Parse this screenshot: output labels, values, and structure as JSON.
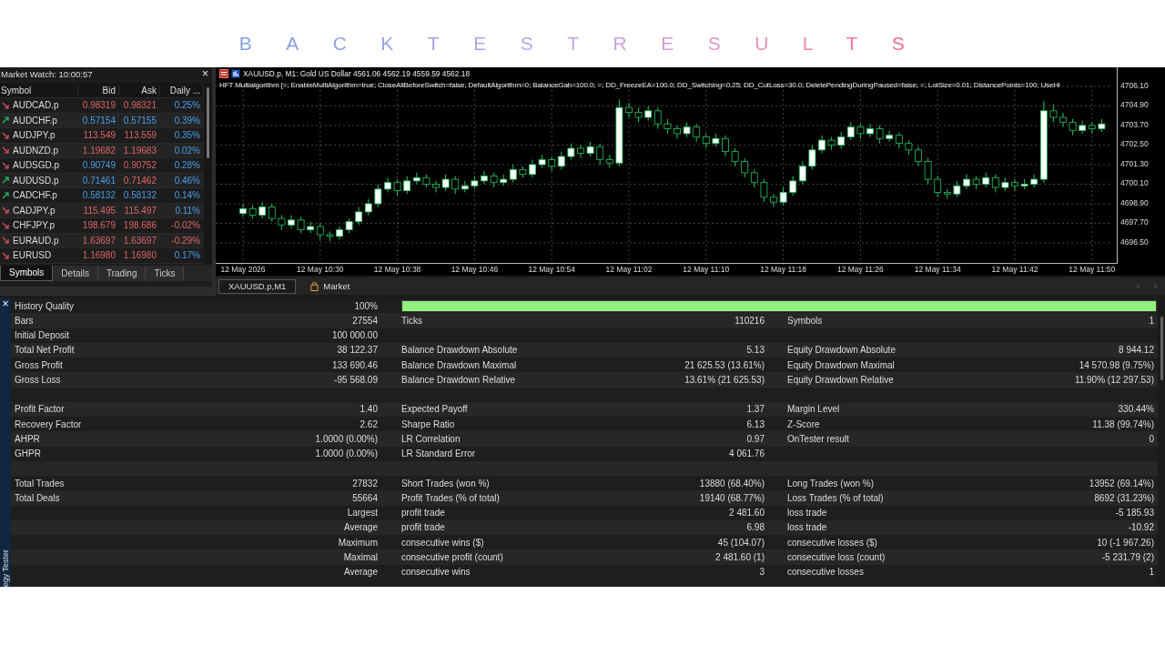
{
  "title": "BACKTESTRESULTS",
  "market_watch": {
    "title": "Market Watch: 10:00:57",
    "close": "×",
    "columns": [
      "Symbol",
      "Bid",
      "Ask",
      "Daily ..."
    ],
    "rows": [
      {
        "symbol": "AUDCAD.p",
        "bid": "0.98319",
        "ask": "0.98321",
        "change": "0.25%",
        "rising": false,
        "bid_up": false,
        "ask_up": false,
        "change_up": true
      },
      {
        "symbol": "AUDCHF.p",
        "bid": "0.57154",
        "ask": "0.57155",
        "change": "0.39%",
        "rising": true,
        "bid_up": true,
        "ask_up": true,
        "change_up": true
      },
      {
        "symbol": "AUDJPY.p",
        "bid": "113.549",
        "ask": "113.559",
        "change": "0.35%",
        "rising": false,
        "bid_up": false,
        "ask_up": false,
        "change_up": true
      },
      {
        "symbol": "AUDNZD.p",
        "bid": "1.19682",
        "ask": "1.19683",
        "change": "0.02%",
        "rising": false,
        "bid_up": false,
        "ask_up": false,
        "change_up": true
      },
      {
        "symbol": "AUDSGD.p",
        "bid": "0.90749",
        "ask": "0.90752",
        "change": "0.28%",
        "rising": false,
        "bid_up": true,
        "ask_up": false,
        "change_up": true
      },
      {
        "symbol": "AUDUSD.p",
        "bid": "0.71461",
        "ask": "0.71462",
        "change": "0.46%",
        "rising": true,
        "bid_up": true,
        "ask_up": false,
        "change_up": true
      },
      {
        "symbol": "CADCHF.p",
        "bid": "0.58132",
        "ask": "0.58132",
        "change": "0.14%",
        "rising": true,
        "bid_up": true,
        "ask_up": true,
        "change_up": true
      },
      {
        "symbol": "CADJPY.p",
        "bid": "115.495",
        "ask": "115.497",
        "change": "0.11%",
        "rising": false,
        "bid_up": false,
        "ask_up": false,
        "change_up": true
      },
      {
        "symbol": "CHFJPY.p",
        "bid": "198.679",
        "ask": "198.686",
        "change": "-0.02%",
        "rising": false,
        "bid_up": false,
        "ask_up": false,
        "change_up": false
      },
      {
        "symbol": "EURAUD.p",
        "bid": "1.63697",
        "ask": "1.63697",
        "change": "-0.29%",
        "rising": false,
        "bid_up": false,
        "ask_up": false,
        "change_up": false
      },
      {
        "symbol": "EURUSD",
        "bid": "1.16980",
        "ask": "1.16980",
        "change": "0.17%",
        "rising": false,
        "bid_up": false,
        "ask_up": false,
        "change_up": true
      }
    ],
    "tabs": [
      {
        "label": "Symbols",
        "selected": true
      },
      {
        "label": "Details",
        "selected": false
      },
      {
        "label": "Trading",
        "selected": false
      },
      {
        "label": "Ticks",
        "selected": false
      }
    ]
  },
  "chart": {
    "header": "XAUUSD.p, M1:  Gold US Dollar  4561.06 4562.19 4559.59 4562.18",
    "expert": "HFT Multialgorithm [=; EnableMultiAlgorithm=true; CloseAllBeforeSwitch=false; DefaultAlgorithm=0; BalanceGab=100.0; =; DD_FreezeEA=100.0; DD_Switching=0.25; DD_CutLoss=30.0; DeletePendingDuringPaused=false; =; LotSize=0.01; DistancePoints=100; UseHi",
    "chart_data": {
      "type": "candlestick",
      "grid": true,
      "ylim": [
        4695.27,
        4707.27
      ],
      "yticks": [
        {
          "value": 4706.1,
          "label": "4706.10"
        },
        {
          "value": 4704.9,
          "label": "4704.90"
        },
        {
          "value": 4703.7,
          "label": "4703.70"
        },
        {
          "value": 4702.5,
          "label": "4702.50"
        },
        {
          "value": 4701.3,
          "label": "4701.30"
        },
        {
          "value": 4700.1,
          "label": "4700.10"
        },
        {
          "value": 4698.9,
          "label": "4698.90"
        },
        {
          "value": 4697.7,
          "label": "4697.70"
        },
        {
          "value": 4696.5,
          "label": "4696.50"
        }
      ],
      "categories": [
        "12 May 2026",
        null,
        null,
        null,
        null,
        null,
        null,
        null,
        "12 May 10:30",
        null,
        null,
        null,
        null,
        null,
        null,
        null,
        "12 May 10:38",
        null,
        null,
        null,
        null,
        null,
        null,
        null,
        "12 May 10:46",
        null,
        null,
        null,
        null,
        null,
        null,
        null,
        "12 May 10:54",
        null,
        null,
        null,
        null,
        null,
        null,
        null,
        "12 May 11:02",
        null,
        null,
        null,
        null,
        null,
        null,
        null,
        "12 May 11:10",
        null,
        null,
        null,
        null,
        null,
        null,
        null,
        "12 May 11:18",
        null,
        null,
        null,
        null,
        null,
        null,
        null,
        "12 May 11:26",
        null,
        null,
        null,
        null,
        null,
        null,
        null,
        "12 May 11:34",
        null,
        null,
        null,
        null,
        null,
        null,
        null,
        "12 May 11:42",
        null,
        null,
        null,
        null,
        null,
        null,
        null,
        "12 May 11:50",
        null
      ],
      "ohlc": [
        [
          4698.3,
          4698.9,
          4698.1,
          4698.6
        ],
        [
          4698.6,
          4698.8,
          4698.0,
          4698.2
        ],
        [
          4698.2,
          4699.0,
          4698.0,
          4698.7
        ],
        [
          4698.7,
          4698.9,
          4697.8,
          4698.0
        ],
        [
          4698.0,
          4698.2,
          4697.3,
          4697.6
        ],
        [
          4697.6,
          4698.2,
          4697.4,
          4697.9
        ],
        [
          4697.9,
          4698.1,
          4697.1,
          4697.3
        ],
        [
          4697.3,
          4697.8,
          4697.1,
          4697.5
        ],
        [
          4697.5,
          4697.7,
          4696.7,
          4697.0
        ],
        [
          4697.0,
          4697.2,
          4696.6,
          4696.9
        ],
        [
          4696.9,
          4697.5,
          4696.7,
          4697.3
        ],
        [
          4697.3,
          4698.0,
          4697.1,
          4697.8
        ],
        [
          4697.8,
          4698.7,
          4697.6,
          4698.4
        ],
        [
          4698.4,
          4699.2,
          4698.2,
          4698.9
        ],
        [
          4698.9,
          4700.1,
          4698.7,
          4699.8
        ],
        [
          4699.8,
          4700.5,
          4699.6,
          4700.2
        ],
        [
          4700.2,
          4700.4,
          4699.4,
          4699.7
        ],
        [
          4699.7,
          4700.6,
          4699.5,
          4700.3
        ],
        [
          4700.3,
          4700.8,
          4700.1,
          4700.5
        ],
        [
          4700.5,
          4700.7,
          4699.9,
          4700.1
        ],
        [
          4700.1,
          4700.3,
          4699.6,
          4699.9
        ],
        [
          4699.9,
          4700.7,
          4699.7,
          4700.4
        ],
        [
          4700.4,
          4700.6,
          4699.5,
          4699.8
        ],
        [
          4699.8,
          4700.3,
          4699.6,
          4700.0
        ],
        [
          4700.0,
          4700.6,
          4699.8,
          4700.3
        ],
        [
          4700.3,
          4700.9,
          4700.1,
          4700.6
        ],
        [
          4700.6,
          4700.8,
          4699.9,
          4700.2
        ],
        [
          4700.2,
          4700.7,
          4700.0,
          4700.4
        ],
        [
          4700.4,
          4701.3,
          4700.2,
          4701.0
        ],
        [
          4701.0,
          4701.2,
          4700.5,
          4700.7
        ],
        [
          4700.7,
          4701.6,
          4700.5,
          4701.3
        ],
        [
          4701.3,
          4701.9,
          4701.1,
          4701.6
        ],
        [
          4701.6,
          4701.8,
          4700.9,
          4701.2
        ],
        [
          4701.2,
          4702.1,
          4701.0,
          4701.8
        ],
        [
          4701.8,
          4702.6,
          4701.6,
          4702.3
        ],
        [
          4702.3,
          4702.5,
          4701.7,
          4702.0
        ],
        [
          4702.0,
          4702.7,
          4701.8,
          4702.4
        ],
        [
          4702.4,
          4702.6,
          4701.3,
          4701.6
        ],
        [
          4701.6,
          4701.9,
          4701.1,
          4701.4
        ],
        [
          4701.4,
          4705.3,
          4701.2,
          4704.8
        ],
        [
          4704.8,
          4705.1,
          4704.2,
          4704.5
        ],
        [
          4704.5,
          4704.8,
          4703.9,
          4704.2
        ],
        [
          4704.2,
          4704.9,
          4704.0,
          4704.6
        ],
        [
          4704.6,
          4704.8,
          4703.5,
          4703.8
        ],
        [
          4703.8,
          4704.1,
          4703.2,
          4703.5
        ],
        [
          4703.5,
          4703.7,
          4702.9,
          4703.2
        ],
        [
          4703.2,
          4703.9,
          4703.0,
          4703.6
        ],
        [
          4703.6,
          4703.8,
          4702.7,
          4703.0
        ],
        [
          4703.0,
          4703.2,
          4702.3,
          4702.6
        ],
        [
          4702.6,
          4703.2,
          4702.4,
          4702.9
        ],
        [
          4702.9,
          4703.1,
          4701.8,
          4702.1
        ],
        [
          4702.1,
          4702.3,
          4701.2,
          4701.5
        ],
        [
          4701.5,
          4701.7,
          4700.5,
          4700.8
        ],
        [
          4700.8,
          4701.0,
          4699.9,
          4700.2
        ],
        [
          4700.2,
          4700.4,
          4699.0,
          4699.3
        ],
        [
          4699.3,
          4699.5,
          4698.7,
          4699.0
        ],
        [
          4699.0,
          4699.9,
          4698.8,
          4699.6
        ],
        [
          4699.6,
          4700.6,
          4699.4,
          4700.3
        ],
        [
          4700.3,
          4701.5,
          4700.1,
          4701.2
        ],
        [
          4701.2,
          4702.5,
          4701.0,
          4702.2
        ],
        [
          4702.2,
          4703.1,
          4702.0,
          4702.8
        ],
        [
          4702.8,
          4703.0,
          4702.2,
          4702.5
        ],
        [
          4702.5,
          4703.3,
          4702.3,
          4703.0
        ],
        [
          4703.0,
          4703.9,
          4702.8,
          4703.6
        ],
        [
          4703.6,
          4703.8,
          4702.9,
          4703.2
        ],
        [
          4703.2,
          4703.8,
          4703.0,
          4703.5
        ],
        [
          4703.5,
          4703.7,
          4702.6,
          4702.9
        ],
        [
          4702.9,
          4703.4,
          4702.7,
          4703.1
        ],
        [
          4703.1,
          4703.3,
          4702.3,
          4702.6
        ],
        [
          4702.6,
          4702.8,
          4701.9,
          4702.2
        ],
        [
          4702.2,
          4702.4,
          4701.2,
          4701.5
        ],
        [
          4701.5,
          4701.7,
          4700.1,
          4700.4
        ],
        [
          4700.4,
          4700.6,
          4699.3,
          4699.6
        ],
        [
          4699.6,
          4699.8,
          4699.2,
          4699.5
        ],
        [
          4699.5,
          4700.3,
          4699.3,
          4700.0
        ],
        [
          4700.0,
          4700.7,
          4699.8,
          4700.4
        ],
        [
          4700.4,
          4700.6,
          4699.8,
          4700.1
        ],
        [
          4700.1,
          4700.8,
          4699.9,
          4700.5
        ],
        [
          4700.5,
          4700.7,
          4699.6,
          4699.9
        ],
        [
          4699.9,
          4700.5,
          4699.7,
          4700.2
        ],
        [
          4700.2,
          4700.4,
          4699.7,
          4700.0
        ],
        [
          4700.0,
          4700.4,
          4699.8,
          4700.1
        ],
        [
          4700.1,
          4700.7,
          4699.9,
          4700.4
        ],
        [
          4700.4,
          4705.2,
          4700.2,
          4704.6
        ],
        [
          4704.6,
          4705.0,
          4703.9,
          4704.2
        ],
        [
          4704.2,
          4704.5,
          4703.6,
          4703.9
        ],
        [
          4703.9,
          4704.1,
          4703.1,
          4703.4
        ],
        [
          4703.4,
          4704.0,
          4703.2,
          4703.7
        ],
        [
          4703.7,
          4703.9,
          4703.2,
          4703.5
        ],
        [
          4703.5,
          4704.1,
          4703.3,
          4703.8
        ]
      ]
    },
    "tabs": [
      {
        "label": "XAUUSD.p,M1",
        "selected": true,
        "kind": "chart"
      },
      {
        "label": "Market",
        "selected": false,
        "kind": "market"
      }
    ]
  },
  "tester": {
    "side_label": "egy Tester",
    "close": "×",
    "rows": [
      {
        "kind": "quality",
        "label": "History Quality",
        "value": "100%",
        "level": 1.0
      },
      {
        "kind": "stats",
        "cells": [
          {
            "label": "Bars",
            "value": "27554"
          },
          {
            "label": "Ticks",
            "value": "110216"
          },
          {
            "label": "Symbols",
            "value": "1"
          }
        ]
      },
      {
        "kind": "stats",
        "cells": [
          {
            "label": "Initial Deposit",
            "value": "100 000.00"
          },
          null,
          null
        ]
      },
      {
        "kind": "stats",
        "cells": [
          {
            "label": "Total Net Profit",
            "value": "38 122.37"
          },
          {
            "label": "Balance Drawdown Absolute",
            "value": "5.13"
          },
          {
            "label": "Equity Drawdown Absolute",
            "value": "8 944.12"
          }
        ]
      },
      {
        "kind": "stats",
        "cells": [
          {
            "label": "Gross Profit",
            "value": "133 690.46"
          },
          {
            "label": "Balance Drawdown Maximal",
            "value": "21 625.53 (13.61%)"
          },
          {
            "label": "Equity Drawdown Maximal",
            "value": "14 570.98 (9.75%)"
          }
        ]
      },
      {
        "kind": "stats",
        "cells": [
          {
            "label": "Gross Loss",
            "value": "-95 568.09"
          },
          {
            "label": "Balance Drawdown Relative",
            "value": "13.61% (21 625.53)"
          },
          {
            "label": "Equity Drawdown Relative",
            "value": "11.90% (12 297.53)"
          }
        ]
      },
      {
        "kind": "blank"
      },
      {
        "kind": "stats",
        "cells": [
          {
            "label": "Profit Factor",
            "value": "1.40"
          },
          {
            "label": "Expected Payoff",
            "value": "1.37"
          },
          {
            "label": "Margin Level",
            "value": "330.44%"
          }
        ]
      },
      {
        "kind": "stats",
        "cells": [
          {
            "label": "Recovery Factor",
            "value": "2.62"
          },
          {
            "label": "Sharpe Ratio",
            "value": "6.13"
          },
          {
            "label": "Z-Score",
            "value": "11.38 (99.74%)"
          }
        ]
      },
      {
        "kind": "stats",
        "cells": [
          {
            "label": "AHPR",
            "value": "1.0000 (0.00%)"
          },
          {
            "label": "LR Correlation",
            "value": "0.97"
          },
          {
            "label": "OnTester result",
            "value": "0"
          }
        ]
      },
      {
        "kind": "stats",
        "cells": [
          {
            "label": "GHPR",
            "value": "1.0000 (0.00%)"
          },
          {
            "label": "LR Standard Error",
            "value": "4 061.76"
          },
          null
        ]
      },
      {
        "kind": "blank"
      },
      {
        "kind": "stats",
        "cells": [
          {
            "label": "Total Trades",
            "value": "27832"
          },
          {
            "label": "Short Trades (won %)",
            "value": "13880 (68.40%)"
          },
          {
            "label": "Long Trades (won %)",
            "value": "13952 (69.14%)"
          }
        ]
      },
      {
        "kind": "stats",
        "cells": [
          {
            "label": "Total Deals",
            "value": "55664"
          },
          {
            "label": "Profit Trades (% of total)",
            "value": "19140 (68.77%)"
          },
          {
            "label": "Loss Trades (% of total)",
            "value": "8692 (31.23%)"
          }
        ]
      },
      {
        "kind": "stats",
        "cells": [
          {
            "value": "Largest"
          },
          {
            "label": "profit trade",
            "value": "2 481.60"
          },
          {
            "label": "loss trade",
            "value": "-5 185.93"
          }
        ]
      },
      {
        "kind": "stats",
        "cells": [
          {
            "value": "Average"
          },
          {
            "label": "profit trade",
            "value": "6.98"
          },
          {
            "label": "loss trade",
            "value": "-10.92"
          }
        ]
      },
      {
        "kind": "stats",
        "cells": [
          {
            "value": "Maximum"
          },
          {
            "label": "consecutive wins ($)",
            "value": "45 (104.07)"
          },
          {
            "label": "consecutive losses ($)",
            "value": "10 (-1 967.26)"
          }
        ]
      },
      {
        "kind": "stats",
        "cells": [
          {
            "value": "Maximal"
          },
          {
            "label": "consecutive profit (count)",
            "value": "2 481.60 (1)"
          },
          {
            "label": "consecutive loss (count)",
            "value": "-5 231.79 (2)"
          }
        ]
      },
      {
        "kind": "stats",
        "cells": [
          {
            "value": "Average"
          },
          {
            "label": "consecutive wins",
            "value": "3"
          },
          {
            "label": "consecutive losses",
            "value": "1"
          }
        ]
      }
    ]
  }
}
